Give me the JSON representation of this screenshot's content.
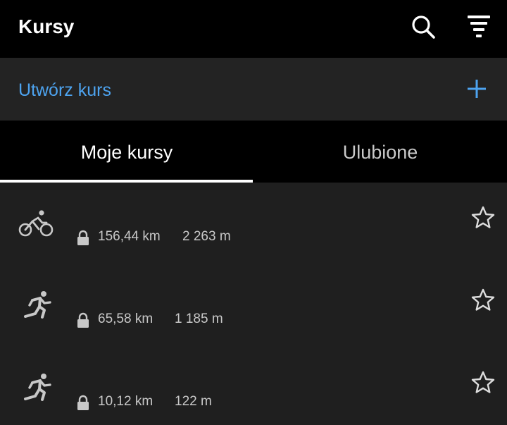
{
  "header": {
    "title": "Kursy",
    "search_icon": "search-icon",
    "filter_icon": "filter-icon"
  },
  "create": {
    "label": "Utwórz kurs",
    "icon": "plus-icon"
  },
  "tabs": [
    {
      "label": "Moje kursy",
      "active": true
    },
    {
      "label": "Ulubione",
      "active": false
    }
  ],
  "courses": [
    {
      "activity_icon": "cycling-icon",
      "locked": true,
      "distance": "156,44 km",
      "elevation": "2 263 m",
      "favorite": false
    },
    {
      "activity_icon": "running-icon",
      "locked": true,
      "distance": "65,58 km",
      "elevation": "1 185 m",
      "favorite": false
    },
    {
      "activity_icon": "running-icon",
      "locked": true,
      "distance": "10,12 km",
      "elevation": "122 m",
      "favorite": false
    }
  ],
  "colors": {
    "accent": "#4da3ef",
    "background": "#1f1f1f",
    "header_background": "#000000",
    "text_primary": "#ffffff",
    "text_secondary": "#c8c8c8"
  }
}
